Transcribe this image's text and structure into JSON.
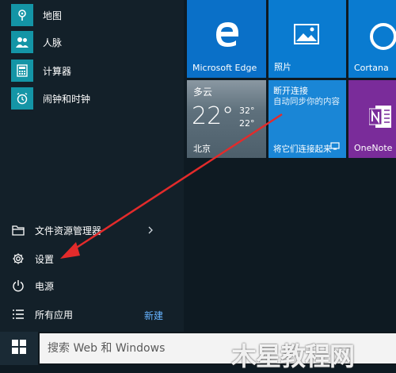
{
  "app_list": {
    "items": [
      {
        "label": "地图",
        "icon": "map-icon"
      },
      {
        "label": "人脉",
        "icon": "people-icon"
      },
      {
        "label": "计算器",
        "icon": "calculator-icon"
      },
      {
        "label": "闹钟和时钟",
        "icon": "alarm-clock-icon"
      }
    ]
  },
  "system_menu": {
    "file_explorer": "文件资源管理器",
    "settings": "设置",
    "power": "电源",
    "all_apps": "所有应用",
    "new_badge": "新建"
  },
  "tiles": {
    "edge": "Microsoft Edge",
    "photos": "照片",
    "cortana": "Cortana",
    "weather": {
      "condition": "多云",
      "temp": "22°",
      "high": "32°",
      "low": "22°",
      "city": "北京"
    },
    "connect": {
      "title": "断开连接",
      "body": "自动同步你的内容",
      "footer": "将它们连接起来"
    },
    "onenote": "OneNote"
  },
  "taskbar": {
    "search_placeholder": "搜索 Web 和 Windows"
  },
  "watermark": "木星教程网",
  "colors": {
    "tile_blue": "#0a7bd0",
    "app_teal": "#1495a6",
    "onenote_purple": "#7a2c9a",
    "arrow_red": "#e32b2b"
  }
}
